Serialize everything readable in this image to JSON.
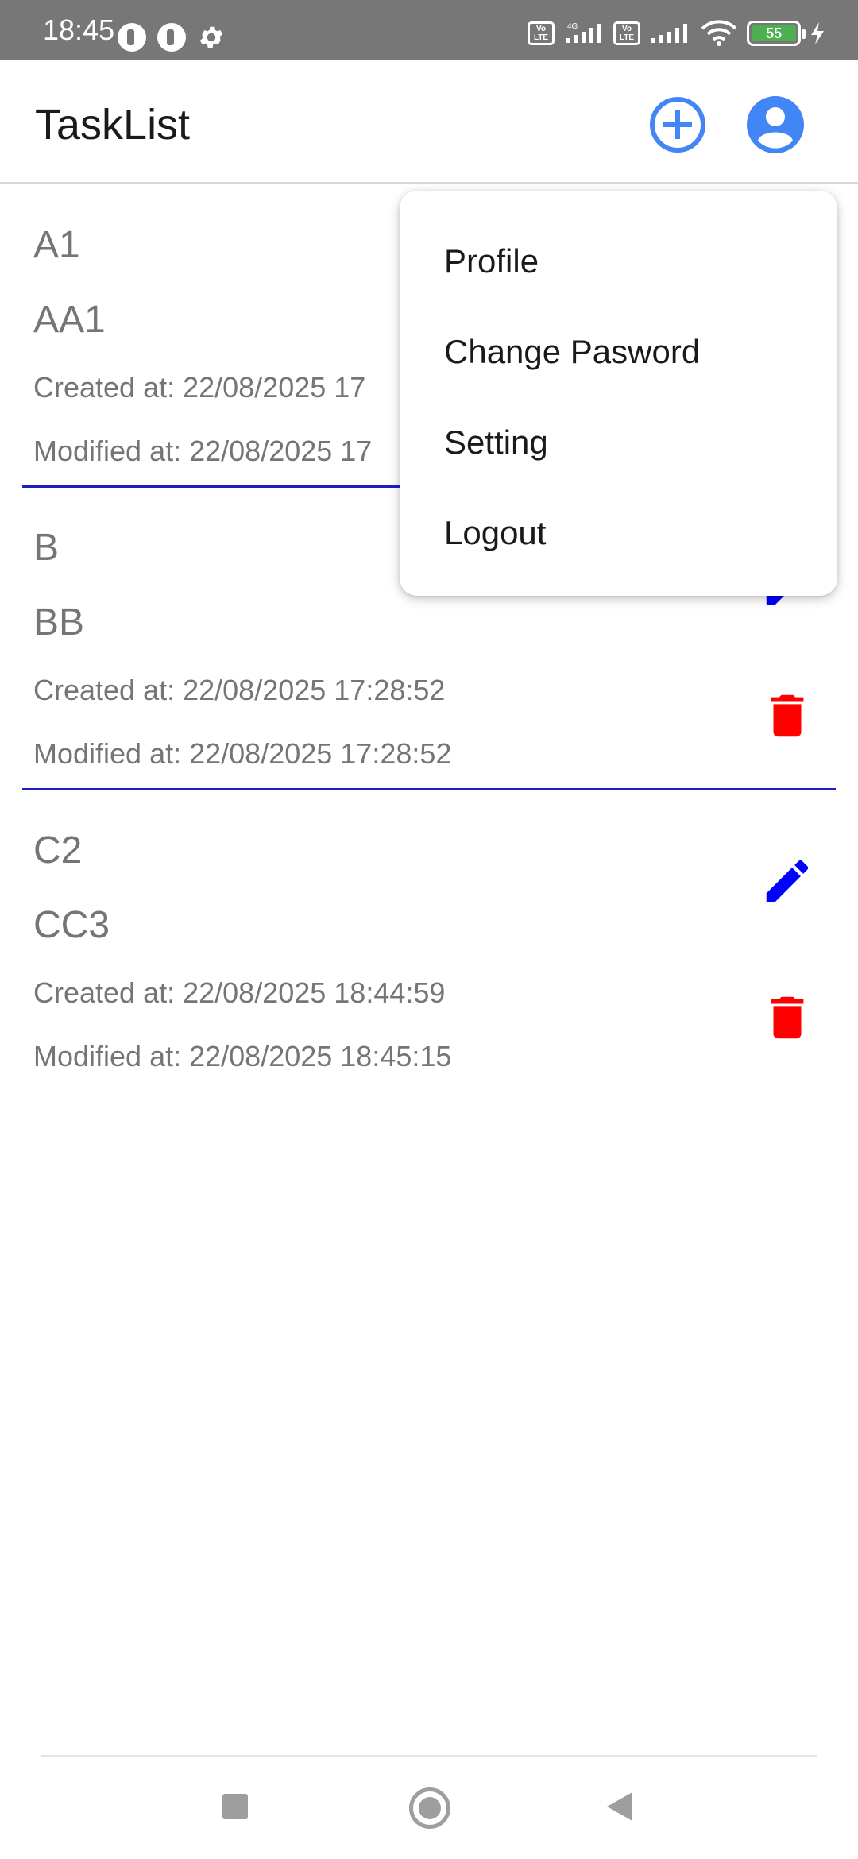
{
  "status_bar": {
    "time": "18:45",
    "battery_level": "55",
    "icons": [
      "notification-icon",
      "notification-icon",
      "gear-icon",
      "volte-icon",
      "signal-4g-icon",
      "volte-icon",
      "signal-icon",
      "wifi-icon",
      "battery-icon",
      "charging-icon"
    ]
  },
  "app_bar": {
    "title": "TaskList",
    "actions": [
      "add-circle-icon",
      "account-circle-icon"
    ]
  },
  "tasks": [
    {
      "title": "A1",
      "description": "AA1",
      "created": "Created at: 22/08/2025 17",
      "modified": "Modified at: 22/08/2025 17"
    },
    {
      "title": "B",
      "description": "BB",
      "created": "Created at: 22/08/2025 17:28:52",
      "modified": "Modified at: 22/08/2025 17:28:52"
    },
    {
      "title": "C2",
      "description": "CC3",
      "created": "Created at: 22/08/2025 18:44:59",
      "modified": "Modified at: 22/08/2025 18:45:15"
    }
  ],
  "menu": {
    "items": [
      "Profile",
      "Change Pasword",
      "Setting",
      "Logout"
    ]
  },
  "colors": {
    "accent": "#4285f4",
    "edit": "#0000ff",
    "delete": "#ff0000",
    "divider": "#1f1fbf",
    "status_bar": "#777777"
  }
}
